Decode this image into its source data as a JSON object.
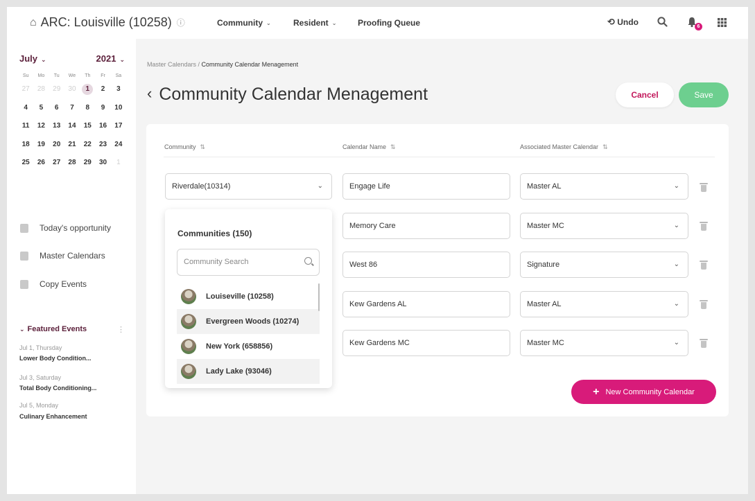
{
  "header": {
    "title": "ARC: Louisville (10258)",
    "nav": [
      "Community",
      "Resident",
      "Proofing Queue"
    ],
    "undo_label": "Undo",
    "notification_count": "6",
    "icons": [
      "home-icon",
      "info-icon",
      "undo-icon",
      "search-icon",
      "bell-icon",
      "apps-grid-icon"
    ]
  },
  "sidebar": {
    "calendar": {
      "month": "July",
      "year": "2021",
      "day_names": [
        "Su",
        "Mo",
        "Tu",
        "We",
        "Th",
        "Fr",
        "Sa"
      ],
      "weeks": [
        [
          "27",
          "28",
          "29",
          "30",
          "1",
          "2",
          "3"
        ],
        [
          "4",
          "5",
          "6",
          "7",
          "8",
          "9",
          "10"
        ],
        [
          "11",
          "12",
          "13",
          "14",
          "15",
          "16",
          "17"
        ],
        [
          "18",
          "19",
          "20",
          "21",
          "22",
          "23",
          "24"
        ],
        [
          "25",
          "26",
          "27",
          "28",
          "29",
          "30",
          "1"
        ]
      ],
      "today": "1"
    },
    "links": [
      "Today's opportunity",
      "Master Calendars",
      "Copy Events"
    ],
    "featured_title": "Featured Events",
    "featured": [
      {
        "date": "Jul 1, Thursday",
        "name": "Lower Body Condition..."
      },
      {
        "date": "Jul 3, Saturday",
        "name": "Total Body Conditioning..."
      },
      {
        "date": "Jul 5, Monday",
        "name": "Culinary Enhancement"
      }
    ]
  },
  "main": {
    "breadcrumb": {
      "parent": "Master Calendars",
      "separator": " / ",
      "current": "Community Calendar Menagement"
    },
    "title": "Community Calendar Menagement",
    "cancel_label": "Cancel",
    "save_label": "Save",
    "columns": [
      "Community",
      "Calendar Name",
      "Associated Master Calendar"
    ],
    "rows": [
      {
        "community": "Riverdale(10314)",
        "calendar": "Engage Life",
        "master": "Master AL"
      },
      {
        "community": "",
        "calendar": "Memory Care",
        "master": "Master MC"
      },
      {
        "community": "",
        "calendar": "West 86",
        "master": "Signature"
      },
      {
        "community": "",
        "calendar": "Kew Gardens AL",
        "master": "Master AL"
      },
      {
        "community": "",
        "calendar": "Kew Gardens MC",
        "master": "Master MC"
      }
    ],
    "new_button_label": "New Community Calendar"
  },
  "dropdown": {
    "title": "Communities (150)",
    "search_placeholder": "Community Search",
    "items": [
      "Louiseville (10258)",
      "Evergreen Woods (10274)",
      "New York (658856)",
      "Lady Lake (93046)"
    ]
  },
  "colors": {
    "accent": "#d81b7a",
    "save": "#6dcf8f",
    "brand_text": "#5b1f3a"
  }
}
